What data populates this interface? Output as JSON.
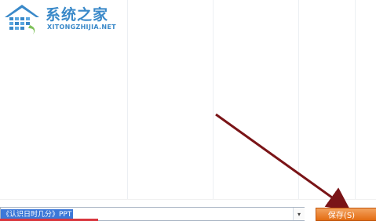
{
  "watermark": {
    "title": "系统之家",
    "url": "XITONGZHIJIA.NET"
  },
  "save_dialog": {
    "filename_value": "《认识日时几分》PPT",
    "save_label": "保存(S)"
  },
  "colors": {
    "accent": "#e36c12",
    "selection": "#3c78d8",
    "annotation_arrow": "#7a1417",
    "watermark": "#3a89c9"
  }
}
